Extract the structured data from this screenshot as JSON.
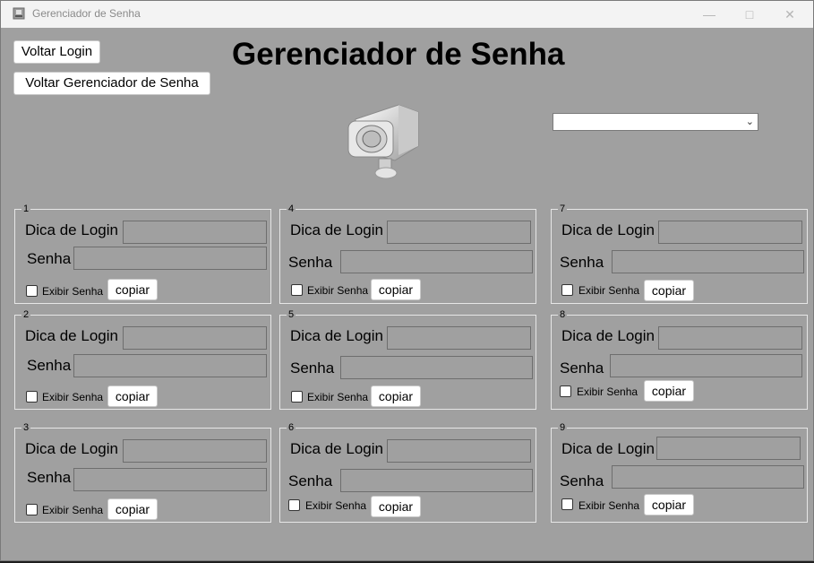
{
  "window": {
    "title": "Gerenciador de Senha"
  },
  "header": {
    "title": "Gerenciador de Senha",
    "back_login_label": "Voltar Login",
    "back_manager_label": "Voltar Gerenciador de Senha"
  },
  "dropdown": {
    "selected": ""
  },
  "labels": {
    "login_hint": "Dica de Login",
    "password": "Senha",
    "show_password": "Exibir Senha",
    "copy": "copiar"
  },
  "groups": [
    {
      "number": "1"
    },
    {
      "number": "2"
    },
    {
      "number": "3"
    },
    {
      "number": "4"
    },
    {
      "number": "5"
    },
    {
      "number": "6"
    },
    {
      "number": "7"
    },
    {
      "number": "8"
    },
    {
      "number": "9"
    }
  ]
}
